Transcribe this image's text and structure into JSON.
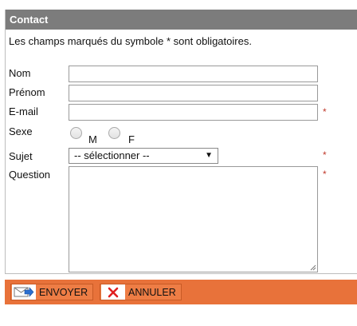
{
  "panel": {
    "title": "Contact",
    "intro": "Les champs marqués du symbole * sont obligatoires."
  },
  "form": {
    "nom_label": "Nom",
    "prenom_label": "Prénom",
    "email_label": "E-mail",
    "sexe_label": "Sexe",
    "sexe_options": [
      "M",
      "F"
    ],
    "sujet_label": "Sujet",
    "sujet_selected": "-- sélectionner --",
    "question_label": "Question",
    "required_mark": "*"
  },
  "footer": {
    "send_label": "ENVOYER",
    "cancel_label": "ANNULER",
    "send_icon": "envelope-send-icon",
    "cancel_icon": "close-icon"
  },
  "colors": {
    "header_bg": "#7c7c7c",
    "footer_bg": "#e8723a",
    "required": "#c0392b",
    "cancel_icon": "#e02020",
    "send_icon": "#2a6fd0"
  }
}
